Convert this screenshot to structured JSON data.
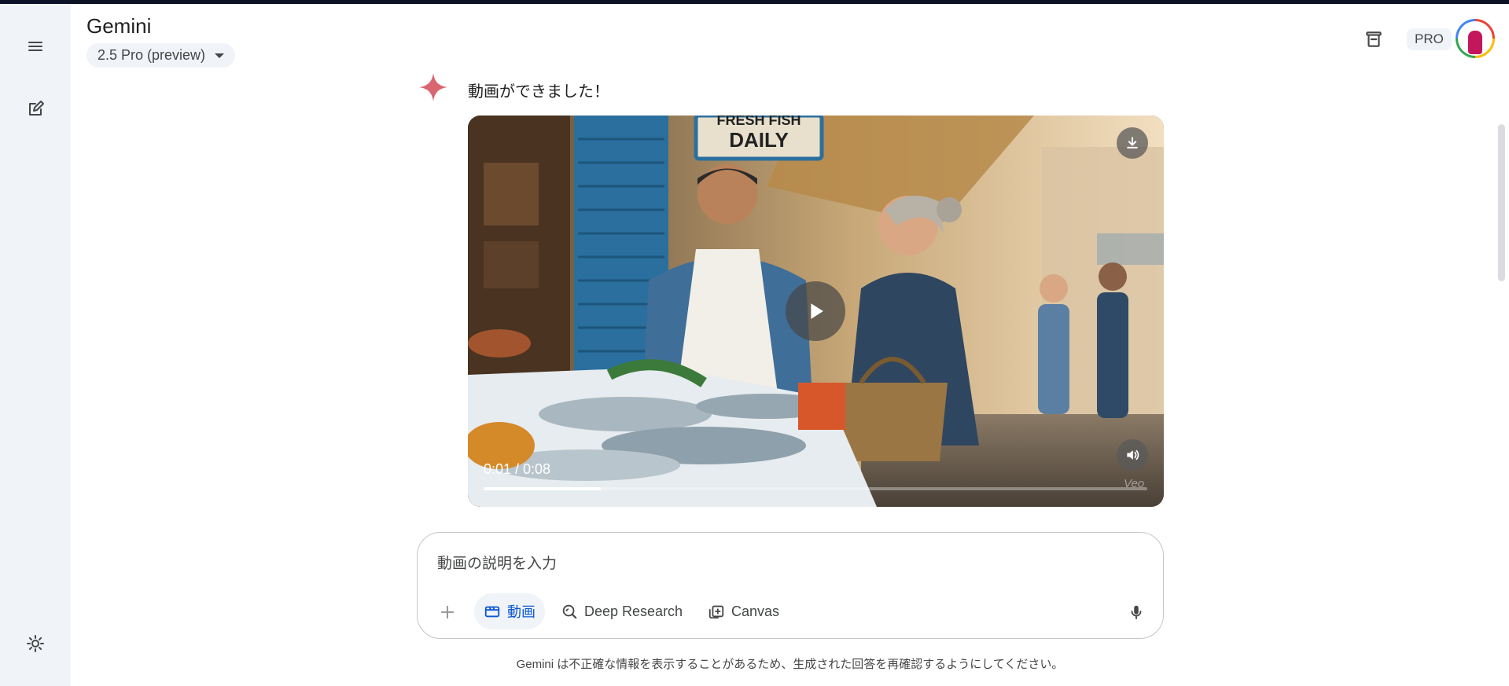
{
  "app": {
    "title": "Gemini",
    "model": "2.5 Pro (preview)"
  },
  "header": {
    "pro_label": "PRO",
    "icons": [
      "delete-chat-icon",
      "avatar"
    ]
  },
  "sidebar": {
    "menu_icon": "menu-icon",
    "new_chat_icon": "edit-icon",
    "settings_icon": "settings-icon"
  },
  "message": {
    "text": "動画ができました！"
  },
  "video": {
    "time": "0:01 / 0:08",
    "progress": 0.177,
    "watermark": "Veo",
    "sign_text": "DAILY",
    "sign_top_text": "FRESH FISH"
  },
  "input": {
    "placeholder": "動画の説明を入力",
    "tools": [
      {
        "label": "動画",
        "icon": "video-icon",
        "active": true
      },
      {
        "label": "Deep Research",
        "icon": "deep-research-icon",
        "active": false
      },
      {
        "label": "Canvas",
        "icon": "canvas-icon",
        "active": false
      }
    ]
  },
  "footer": {
    "disclaimer": "Gemini は不正確な情報を表示することがあるため、生成された回答を再確認するようにしてください。"
  },
  "colors": {
    "sidebar_bg": "#f0f4f9",
    "accent": "#0b57d0",
    "spark": "#d96570"
  }
}
